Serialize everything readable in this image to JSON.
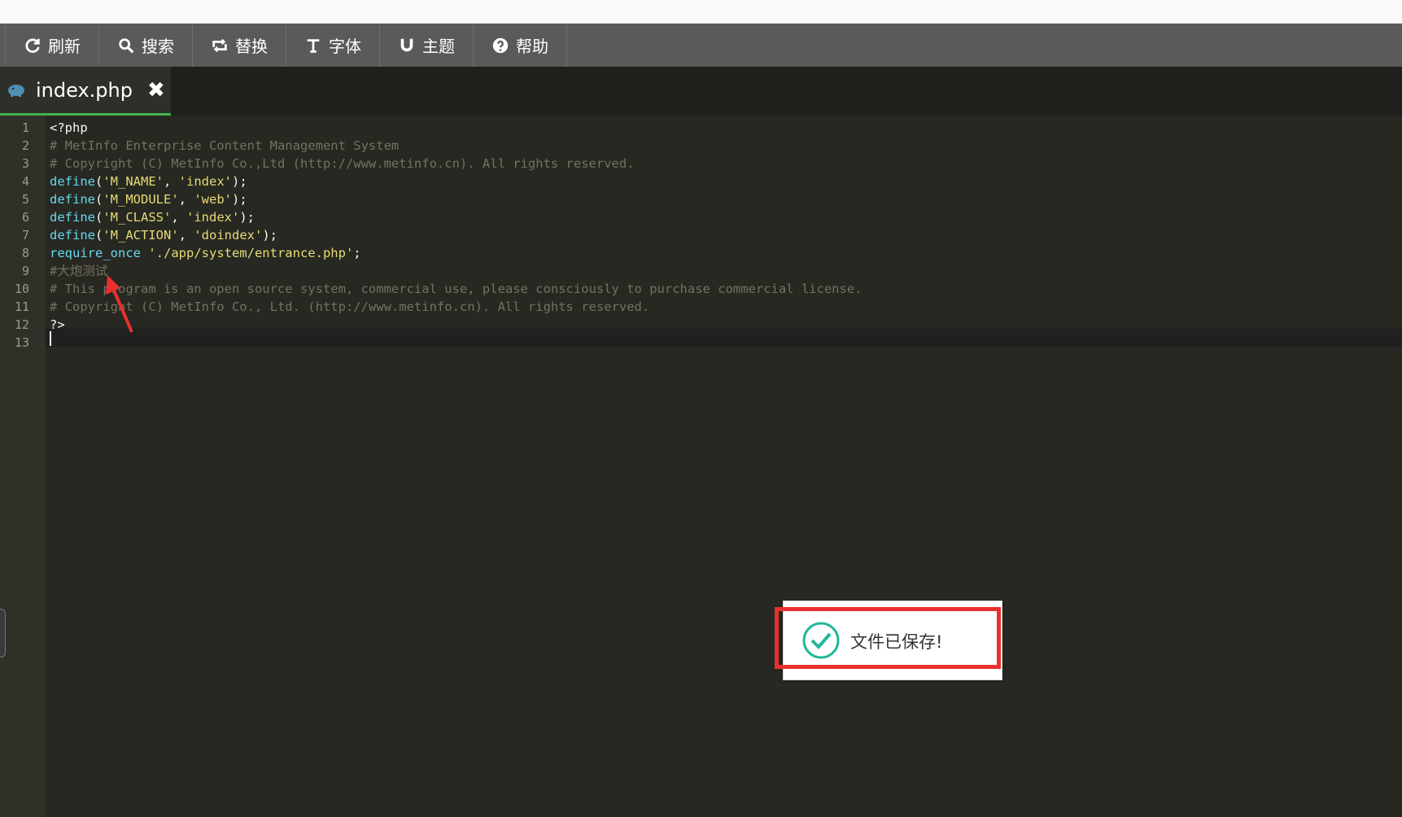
{
  "toolbar": {
    "buttons": [
      {
        "icon": "refresh-icon",
        "label": "刷新"
      },
      {
        "icon": "search-icon",
        "label": "搜索"
      },
      {
        "icon": "replace-icon",
        "label": "替换"
      },
      {
        "icon": "font-icon",
        "label": "字体"
      },
      {
        "icon": "magnet-icon",
        "label": "主题"
      },
      {
        "icon": "help-icon",
        "label": "帮助"
      }
    ]
  },
  "tab": {
    "icon": "php-elephant-icon",
    "filename": "index.php",
    "close_symbol": "✖"
  },
  "editor": {
    "line_numbers": [
      "1",
      "2",
      "3",
      "4",
      "5",
      "6",
      "7",
      "8",
      "9",
      "10",
      "11",
      "12",
      "13"
    ],
    "lines": [
      [
        {
          "t": "<?php",
          "c": "plain"
        }
      ],
      [
        {
          "t": "# MetInfo Enterprise Content Management System",
          "c": "cmt"
        }
      ],
      [
        {
          "t": "# Copyright (C) MetInfo Co.,Ltd (http://www.metinfo.cn). All rights reserved.",
          "c": "cmt"
        }
      ],
      [
        {
          "t": "define",
          "c": "fn"
        },
        {
          "t": "(",
          "c": "plain"
        },
        {
          "t": "'M_NAME'",
          "c": "str"
        },
        {
          "t": ", ",
          "c": "plain"
        },
        {
          "t": "'index'",
          "c": "str"
        },
        {
          "t": ");",
          "c": "plain"
        }
      ],
      [
        {
          "t": "define",
          "c": "fn"
        },
        {
          "t": "(",
          "c": "plain"
        },
        {
          "t": "'M_MODULE'",
          "c": "str"
        },
        {
          "t": ", ",
          "c": "plain"
        },
        {
          "t": "'web'",
          "c": "str"
        },
        {
          "t": ");",
          "c": "plain"
        }
      ],
      [
        {
          "t": "define",
          "c": "fn"
        },
        {
          "t": "(",
          "c": "plain"
        },
        {
          "t": "'M_CLASS'",
          "c": "str"
        },
        {
          "t": ", ",
          "c": "plain"
        },
        {
          "t": "'index'",
          "c": "str"
        },
        {
          "t": ");",
          "c": "plain"
        }
      ],
      [
        {
          "t": "define",
          "c": "fn"
        },
        {
          "t": "(",
          "c": "plain"
        },
        {
          "t": "'M_ACTION'",
          "c": "str"
        },
        {
          "t": ", ",
          "c": "plain"
        },
        {
          "t": "'doindex'",
          "c": "str"
        },
        {
          "t": ");",
          "c": "plain"
        }
      ],
      [
        {
          "t": "require_once",
          "c": "fn"
        },
        {
          "t": " ",
          "c": "plain"
        },
        {
          "t": "'./app/system/entrance.php'",
          "c": "str"
        },
        {
          "t": ";",
          "c": "plain"
        }
      ],
      [
        {
          "t": "#大炮测试",
          "c": "cmt"
        }
      ],
      [
        {
          "t": "# This program is an open source system, commercial use, please consciously to purchase commercial license.",
          "c": "cmt"
        }
      ],
      [
        {
          "t": "# Copyright (C) MetInfo Co., Ltd. (http://www.metinfo.cn). All rights reserved.",
          "c": "cmt"
        }
      ],
      [
        {
          "t": "?>",
          "c": "plain"
        }
      ],
      []
    ],
    "active_line": 13
  },
  "toast": {
    "icon": "check-circle-icon",
    "message": "文件已保存!"
  },
  "colors": {
    "editor_bg": "#272822",
    "comment": "#75715e",
    "function": "#66d9ef",
    "string": "#e6db74",
    "tab_underline": "#41b14f",
    "highlight_box": "#e8302f",
    "check": "#1fb89a"
  }
}
